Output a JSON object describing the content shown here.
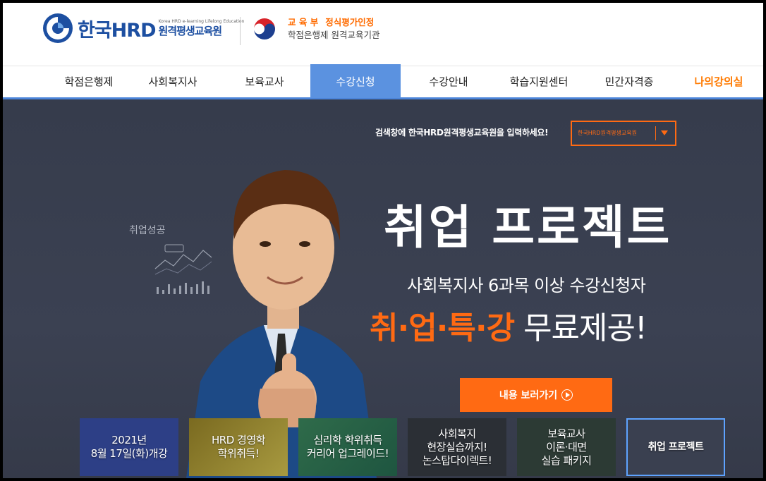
{
  "header": {
    "logo_main": "한국HRD",
    "logo_tagline": "Korea HRD e-learning Lifelong Education",
    "logo_sub": "원격평생교육원",
    "moe_ministry": "교 육 부",
    "moe_cert": "정식평가인정",
    "moe_desc": "학점은행제 원격교육기관"
  },
  "nav": {
    "items": [
      {
        "label": "학점은행제"
      },
      {
        "label": "사회복지사"
      },
      {
        "label": "보육교사"
      },
      {
        "label": "수강신청",
        "active": true
      },
      {
        "label": "수강안내"
      },
      {
        "label": "학습지원센터"
      },
      {
        "label": "민간자격증"
      },
      {
        "label": "나의강의실"
      }
    ]
  },
  "hero": {
    "search_hint": "검색창에 한국HRD원격평생교육원을 입력하세요!",
    "search_value": "한국HRD원격평생교육원",
    "chart_label": "취업성공",
    "title": "취업 프로젝트",
    "subtitle": "사회복지사 6과목 이상 수강신청자",
    "headline_highlight": "취·업·특·강",
    "headline_rest": " 무료제공!",
    "cta_label": "내용 보러가기",
    "colors": {
      "accent": "#ff6a13",
      "bg": "#383e4e",
      "nav_active": "#5b92e0"
    }
  },
  "thumbnails": [
    {
      "label": "2021년\n8월 17일(화)개강"
    },
    {
      "label": "HRD 경영학\n학위취득!"
    },
    {
      "label": "심리학 학위취득\n커리어 업그레이드!"
    },
    {
      "label": "사회복지\n현장실습까지!\n논스탑다이렉트!"
    },
    {
      "label": "보육교사\n이론·대면\n실습 패키지"
    },
    {
      "label": "취업 프로젝트",
      "selected": true
    }
  ]
}
